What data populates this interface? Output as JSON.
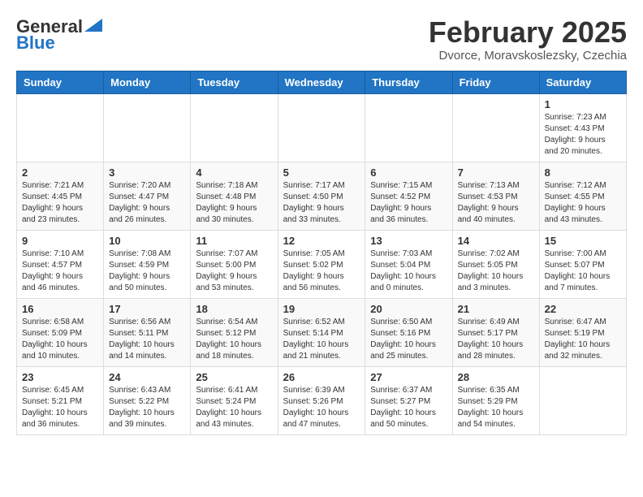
{
  "header": {
    "logo_general": "General",
    "logo_blue": "Blue",
    "month_year": "February 2025",
    "location": "Dvorce, Moravskoslezsky, Czechia"
  },
  "days_of_week": [
    "Sunday",
    "Monday",
    "Tuesday",
    "Wednesday",
    "Thursday",
    "Friday",
    "Saturday"
  ],
  "weeks": [
    [
      {
        "day": "",
        "info": ""
      },
      {
        "day": "",
        "info": ""
      },
      {
        "day": "",
        "info": ""
      },
      {
        "day": "",
        "info": ""
      },
      {
        "day": "",
        "info": ""
      },
      {
        "day": "",
        "info": ""
      },
      {
        "day": "1",
        "info": "Sunrise: 7:23 AM\nSunset: 4:43 PM\nDaylight: 9 hours\nand 20 minutes."
      }
    ],
    [
      {
        "day": "2",
        "info": "Sunrise: 7:21 AM\nSunset: 4:45 PM\nDaylight: 9 hours\nand 23 minutes."
      },
      {
        "day": "3",
        "info": "Sunrise: 7:20 AM\nSunset: 4:47 PM\nDaylight: 9 hours\nand 26 minutes."
      },
      {
        "day": "4",
        "info": "Sunrise: 7:18 AM\nSunset: 4:48 PM\nDaylight: 9 hours\nand 30 minutes."
      },
      {
        "day": "5",
        "info": "Sunrise: 7:17 AM\nSunset: 4:50 PM\nDaylight: 9 hours\nand 33 minutes."
      },
      {
        "day": "6",
        "info": "Sunrise: 7:15 AM\nSunset: 4:52 PM\nDaylight: 9 hours\nand 36 minutes."
      },
      {
        "day": "7",
        "info": "Sunrise: 7:13 AM\nSunset: 4:53 PM\nDaylight: 9 hours\nand 40 minutes."
      },
      {
        "day": "8",
        "info": "Sunrise: 7:12 AM\nSunset: 4:55 PM\nDaylight: 9 hours\nand 43 minutes."
      }
    ],
    [
      {
        "day": "9",
        "info": "Sunrise: 7:10 AM\nSunset: 4:57 PM\nDaylight: 9 hours\nand 46 minutes."
      },
      {
        "day": "10",
        "info": "Sunrise: 7:08 AM\nSunset: 4:59 PM\nDaylight: 9 hours\nand 50 minutes."
      },
      {
        "day": "11",
        "info": "Sunrise: 7:07 AM\nSunset: 5:00 PM\nDaylight: 9 hours\nand 53 minutes."
      },
      {
        "day": "12",
        "info": "Sunrise: 7:05 AM\nSunset: 5:02 PM\nDaylight: 9 hours\nand 56 minutes."
      },
      {
        "day": "13",
        "info": "Sunrise: 7:03 AM\nSunset: 5:04 PM\nDaylight: 10 hours\nand 0 minutes."
      },
      {
        "day": "14",
        "info": "Sunrise: 7:02 AM\nSunset: 5:05 PM\nDaylight: 10 hours\nand 3 minutes."
      },
      {
        "day": "15",
        "info": "Sunrise: 7:00 AM\nSunset: 5:07 PM\nDaylight: 10 hours\nand 7 minutes."
      }
    ],
    [
      {
        "day": "16",
        "info": "Sunrise: 6:58 AM\nSunset: 5:09 PM\nDaylight: 10 hours\nand 10 minutes."
      },
      {
        "day": "17",
        "info": "Sunrise: 6:56 AM\nSunset: 5:11 PM\nDaylight: 10 hours\nand 14 minutes."
      },
      {
        "day": "18",
        "info": "Sunrise: 6:54 AM\nSunset: 5:12 PM\nDaylight: 10 hours\nand 18 minutes."
      },
      {
        "day": "19",
        "info": "Sunrise: 6:52 AM\nSunset: 5:14 PM\nDaylight: 10 hours\nand 21 minutes."
      },
      {
        "day": "20",
        "info": "Sunrise: 6:50 AM\nSunset: 5:16 PM\nDaylight: 10 hours\nand 25 minutes."
      },
      {
        "day": "21",
        "info": "Sunrise: 6:49 AM\nSunset: 5:17 PM\nDaylight: 10 hours\nand 28 minutes."
      },
      {
        "day": "22",
        "info": "Sunrise: 6:47 AM\nSunset: 5:19 PM\nDaylight: 10 hours\nand 32 minutes."
      }
    ],
    [
      {
        "day": "23",
        "info": "Sunrise: 6:45 AM\nSunset: 5:21 PM\nDaylight: 10 hours\nand 36 minutes."
      },
      {
        "day": "24",
        "info": "Sunrise: 6:43 AM\nSunset: 5:22 PM\nDaylight: 10 hours\nand 39 minutes."
      },
      {
        "day": "25",
        "info": "Sunrise: 6:41 AM\nSunset: 5:24 PM\nDaylight: 10 hours\nand 43 minutes."
      },
      {
        "day": "26",
        "info": "Sunrise: 6:39 AM\nSunset: 5:26 PM\nDaylight: 10 hours\nand 47 minutes."
      },
      {
        "day": "27",
        "info": "Sunrise: 6:37 AM\nSunset: 5:27 PM\nDaylight: 10 hours\nand 50 minutes."
      },
      {
        "day": "28",
        "info": "Sunrise: 6:35 AM\nSunset: 5:29 PM\nDaylight: 10 hours\nand 54 minutes."
      },
      {
        "day": "",
        "info": ""
      }
    ]
  ]
}
